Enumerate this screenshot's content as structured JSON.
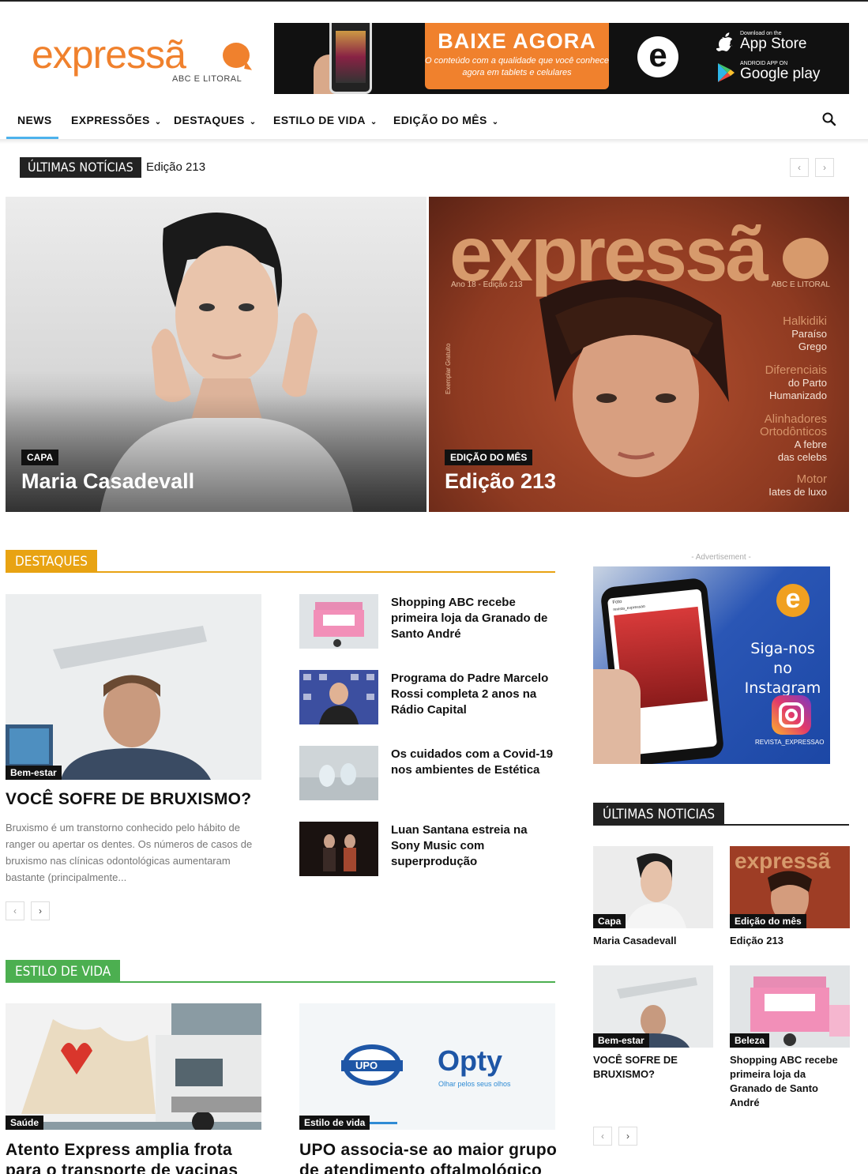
{
  "logo": {
    "word": "expressã",
    "sub": "ABC E LITORAL"
  },
  "banner": {
    "cta_title": "BAIXE AGORA",
    "cta_sub": "O conteúdo com a qualidade que você conhece agora em tablets e celulares",
    "appstore_small": "Download on the",
    "appstore_big": "App Store",
    "gplay_small": "ANDROID APP ON",
    "gplay_big": "Google play",
    "e_letter": "e"
  },
  "nav": {
    "items": [
      "NEWS",
      "EXPRESSÕES",
      "DESTAQUES",
      "ESTILO DE VIDA",
      "EDIÇÃO DO MÊS"
    ],
    "active_color": "#4db2ec"
  },
  "ticker": {
    "label": "ÚLTIMAS NOTÍCIAS",
    "text": "Edição 213",
    "prev": "‹",
    "next": "›"
  },
  "hero": [
    {
      "category": "CAPA",
      "title": "Maria Casadevall"
    },
    {
      "category": "EDIÇÃO DO MÊS",
      "title": "Edição 213",
      "cover": {
        "logo": "expressã",
        "issue": "Ano 18 - Edição 213",
        "region": "ABC E LITORAL",
        "side": "Exemplar Gratuito",
        "headlines": [
          {
            "big": "Halkidiki",
            "rest": [
              "Paraíso",
              "Grego"
            ]
          },
          {
            "big": "Diferenciais",
            "rest": [
              "do Parto",
              "Humanizado"
            ]
          },
          {
            "big": "Alinhadores Ortodônticos",
            "rest": [
              "A febre",
              "das celebs"
            ]
          },
          {
            "big": "Motor",
            "rest": [
              "Iates de luxo"
            ]
          }
        ]
      }
    }
  ],
  "destaques": {
    "label": "DESTAQUES",
    "color": "#e8a313",
    "main": {
      "category": "Bem-estar",
      "title": "VOCÊ SOFRE DE BRUXISMO?",
      "excerpt": "Bruxismo é um transtorno conhecido pelo hábito de ranger ou apertar os dentes. Os números de casos de bruxismo nas clínicas odontológicas aumentaram bastante (principalmente..."
    },
    "list": [
      {
        "title": "Shopping ABC recebe primeira loja da Granado de Santo André"
      },
      {
        "title": "Programa do Padre Marcelo Rossi completa 2 anos na Rádio Capital"
      },
      {
        "title": "Os cuidados com a Covid-19 nos ambientes de Estética"
      },
      {
        "title": "Luan Santana estreia na Sony Music com superprodução"
      }
    ],
    "prev": "‹",
    "next": "›"
  },
  "estilo": {
    "label": "ESTILO DE VIDA",
    "color": "#4caf50",
    "items": [
      {
        "category": "Saúde",
        "title": "Atento Express amplia frota para o transporte de vacinas"
      },
      {
        "category": "Estilo de vida",
        "title": "UPO associa-se ao maior grupo de atendimento oftalmológico",
        "logo1": "UPO",
        "logo2": "Opty",
        "logo2_sub": "Olhar pelos seus olhos"
      }
    ]
  },
  "sidebar": {
    "ad_label": "- Advertisement -",
    "ad": {
      "follow": "Siga-nos no Instagram",
      "handle": "REVISTA_EXPRESSAO",
      "phone_user": "revista_expressao",
      "phone_header": "Foto",
      "e_letter": "e"
    },
    "ultimas_label": "ÚLTIMAS NOTICIAS",
    "cards": [
      {
        "category": "Capa",
        "title": "Maria Casadevall"
      },
      {
        "category": "Edição do mês",
        "title": "Edição 213"
      },
      {
        "category": "Bem-estar",
        "title": "VOCÊ SOFRE DE BRUXISMO?"
      },
      {
        "category": "Beleza",
        "title": "Shopping ABC recebe primeira loja da Granado de Santo André"
      }
    ],
    "prev": "‹",
    "next": "›"
  }
}
